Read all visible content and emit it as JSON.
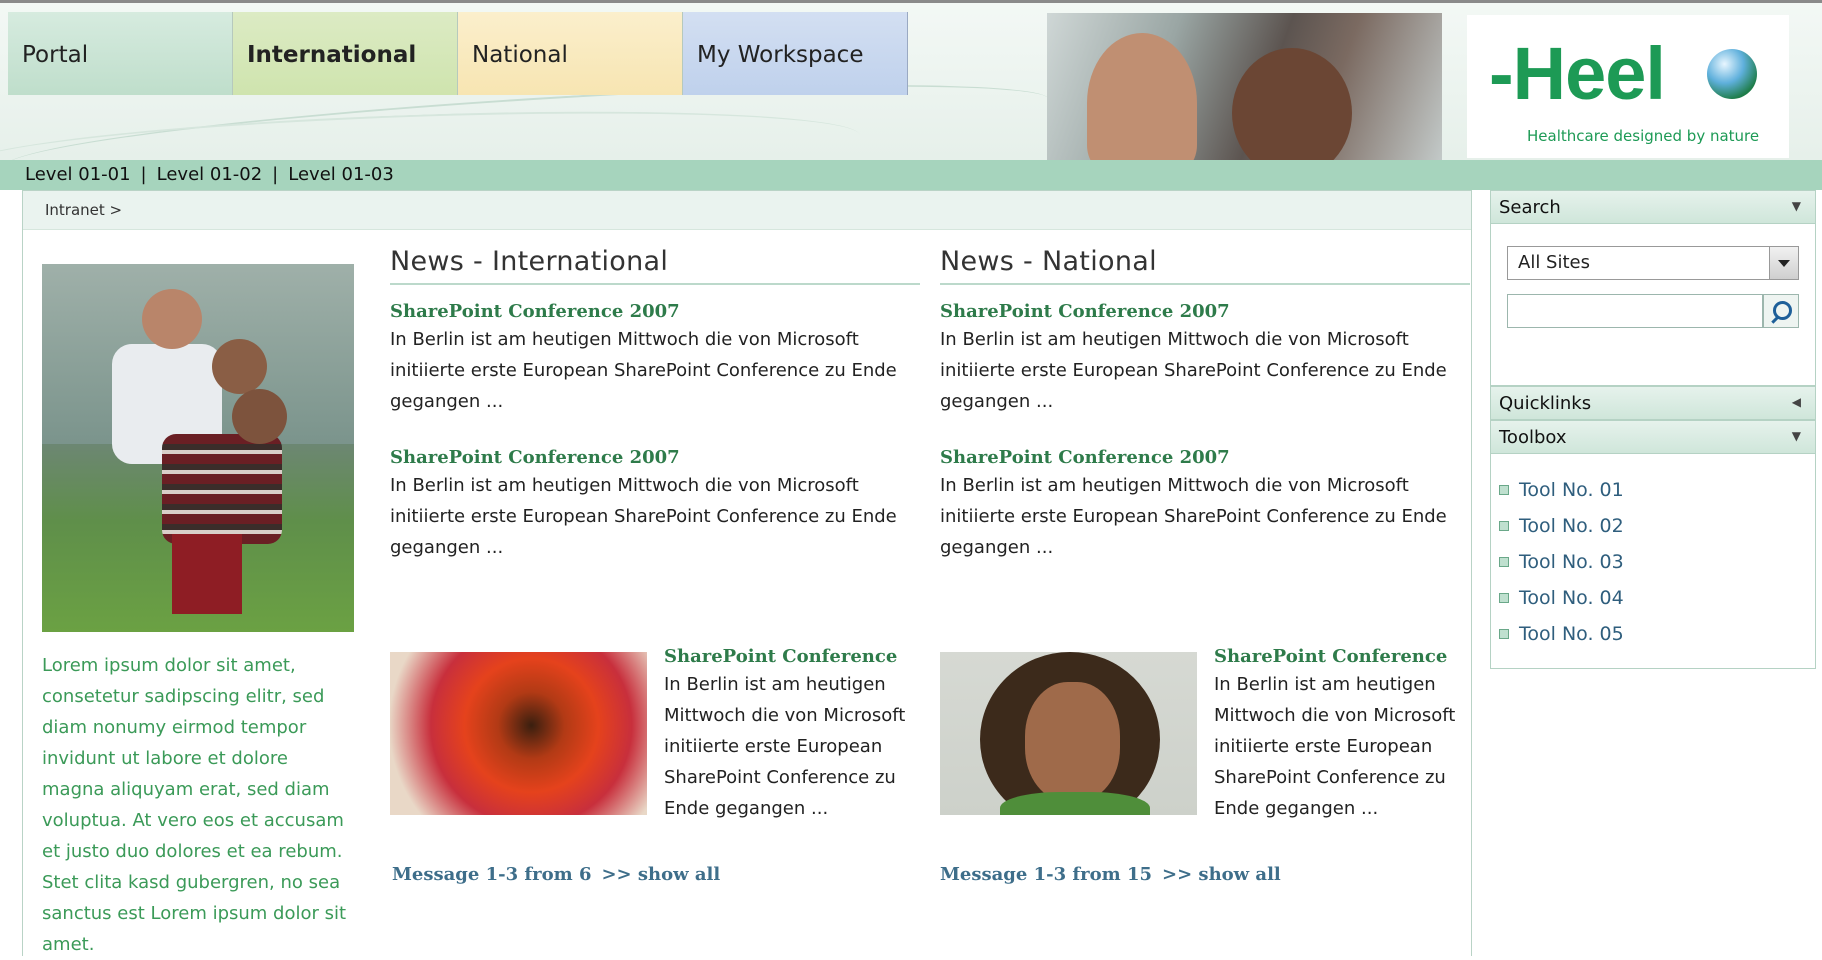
{
  "nav": {
    "tabs": [
      {
        "label": "Portal"
      },
      {
        "label": "International"
      },
      {
        "label": "National"
      },
      {
        "label": "My Workspace"
      }
    ]
  },
  "brand": {
    "logo_text": "-Heel",
    "tagline": "Healthcare designed by nature"
  },
  "levels": [
    "Level 01-01",
    "Level 01-02",
    "Level 01-03"
  ],
  "breadcrumb": "Intranet >",
  "left": {
    "lorem": "Lorem ipsum dolor sit amet, consetetur sadipscing elitr, sed diam nonumy eirmod tempor invidunt ut labore et dolore magna aliquyam erat, sed diam voluptua. At vero eos et accusam et justo duo dolores et ea rebum. Stet clita kasd gubergren, no sea sanctus est Lorem ipsum dolor sit amet."
  },
  "international": {
    "title": "News - International",
    "items": [
      {
        "title": "SharePoint Conference 2007",
        "body": "In Berlin ist am heutigen Mittwoch die von Microsoft initiierte erste European SharePoint Conference zu Ende gegangen ..."
      },
      {
        "title": "SharePoint Conference 2007",
        "body": "In Berlin ist am heutigen Mittwoch die von Microsoft initiierte erste European SharePoint Conference zu Ende gegangen ..."
      }
    ],
    "feature": {
      "title": "SharePoint Conference",
      "body": "In Berlin ist am heutigen Mittwoch die von Microsoft initiierte erste European SharePoint Conference zu Ende gegangen ..."
    },
    "message": "Message 1-3 from 6",
    "show_all": ">> show all"
  },
  "national": {
    "title": "News - National",
    "items": [
      {
        "title": "SharePoint Conference 2007",
        "body": "In Berlin ist am heutigen Mittwoch die von Microsoft initiierte erste European SharePoint Conference zu Ende gegangen ..."
      },
      {
        "title": "SharePoint Conference 2007",
        "body": "In Berlin ist am heutigen Mittwoch die von Microsoft initiierte erste European SharePoint Conference zu Ende gegangen ..."
      }
    ],
    "feature": {
      "title": "SharePoint Conference",
      "body": "In Berlin ist am heutigen Mittwoch die von Microsoft initiierte erste European SharePoint Conference zu Ende gegangen ..."
    },
    "message": "Message 1-3 from 15",
    "show_all": ">> show all"
  },
  "sidebar": {
    "search_label": "Search",
    "scope_value": "All Sites",
    "quicklinks_label": "Quicklinks",
    "toolbox_label": "Toolbox",
    "tools": [
      "Tool No. 01",
      "Tool No. 02",
      "Tool No. 03",
      "Tool No. 04",
      "Tool No. 05"
    ],
    "icons": {
      "search": "search-icon",
      "dropdown": "chevron-down-icon",
      "quicklinks_arrow": "chevron-left-icon",
      "toolbox_arrow": "chevron-down-icon"
    }
  },
  "colors": {
    "brand_green": "#1d9a55",
    "level_bar": "#a6d4bd",
    "news_title": "#2e7b4a",
    "link_blue": "#3e6e8a"
  }
}
